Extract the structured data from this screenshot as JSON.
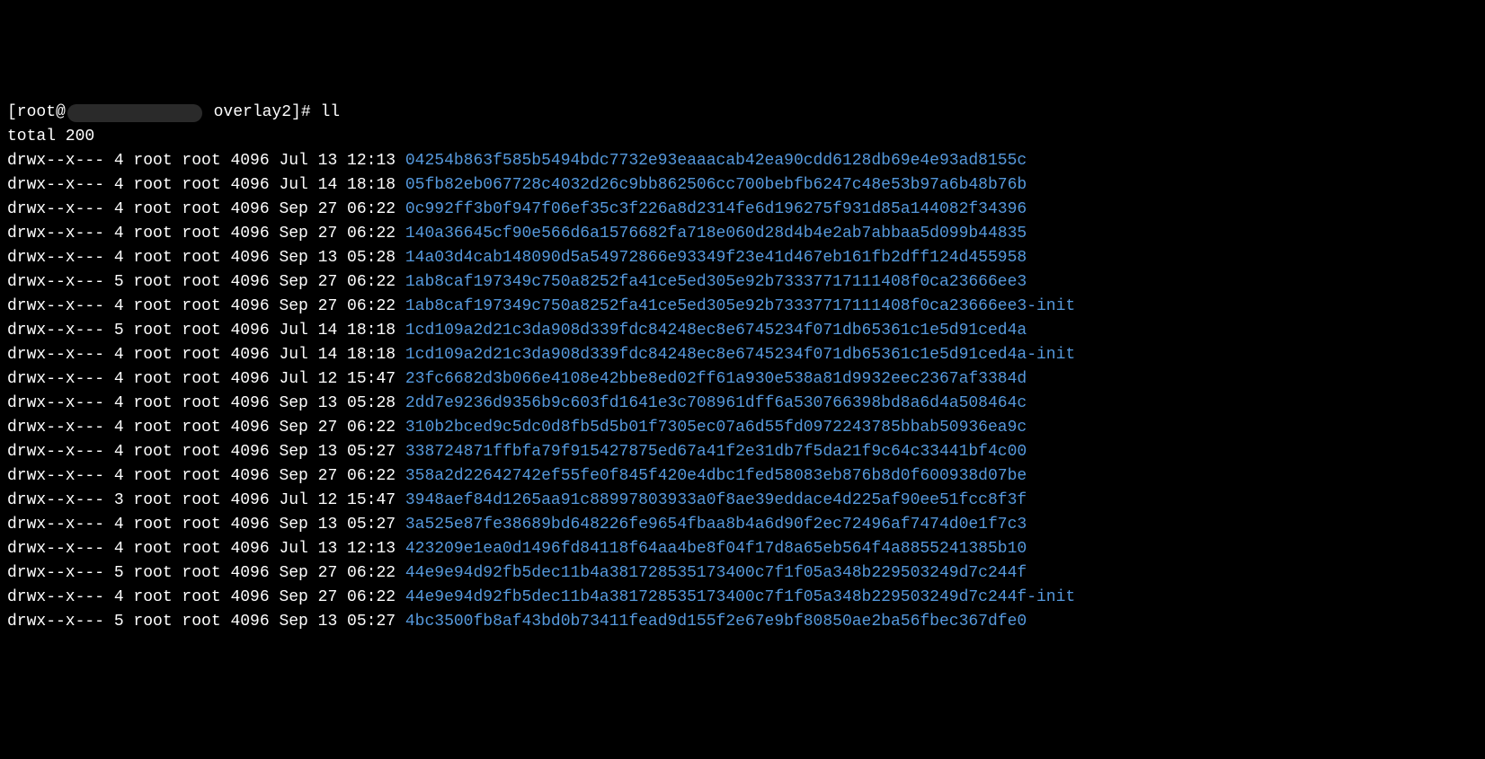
{
  "prompt": {
    "prefix": "[root@",
    "suffix": " overlay2]# ",
    "command": "ll"
  },
  "total": "total 200",
  "rows": [
    {
      "perms": "drwx--x---",
      "links": "4",
      "owner": "root",
      "group": "root",
      "size": "4096",
      "month": "Jul",
      "day": "13",
      "time": "12:13",
      "name": "04254b863f585b5494bdc7732e93eaaacab42ea90cdd6128db69e4e93ad8155c"
    },
    {
      "perms": "drwx--x---",
      "links": "4",
      "owner": "root",
      "group": "root",
      "size": "4096",
      "month": "Jul",
      "day": "14",
      "time": "18:18",
      "name": "05fb82eb067728c4032d26c9bb862506cc700bebfb6247c48e53b97a6b48b76b"
    },
    {
      "perms": "drwx--x---",
      "links": "4",
      "owner": "root",
      "group": "root",
      "size": "4096",
      "month": "Sep",
      "day": "27",
      "time": "06:22",
      "name": "0c992ff3b0f947f06ef35c3f226a8d2314fe6d196275f931d85a144082f34396"
    },
    {
      "perms": "drwx--x---",
      "links": "4",
      "owner": "root",
      "group": "root",
      "size": "4096",
      "month": "Sep",
      "day": "27",
      "time": "06:22",
      "name": "140a36645cf90e566d6a1576682fa718e060d28d4b4e2ab7abbaa5d099b44835"
    },
    {
      "perms": "drwx--x---",
      "links": "4",
      "owner": "root",
      "group": "root",
      "size": "4096",
      "month": "Sep",
      "day": "13",
      "time": "05:28",
      "name": "14a03d4cab148090d5a54972866e93349f23e41d467eb161fb2dff124d455958"
    },
    {
      "perms": "drwx--x---",
      "links": "5",
      "owner": "root",
      "group": "root",
      "size": "4096",
      "month": "Sep",
      "day": "27",
      "time": "06:22",
      "name": "1ab8caf197349c750a8252fa41ce5ed305e92b73337717111408f0ca23666ee3"
    },
    {
      "perms": "drwx--x---",
      "links": "4",
      "owner": "root",
      "group": "root",
      "size": "4096",
      "month": "Sep",
      "day": "27",
      "time": "06:22",
      "name": "1ab8caf197349c750a8252fa41ce5ed305e92b73337717111408f0ca23666ee3-init"
    },
    {
      "perms": "drwx--x---",
      "links": "5",
      "owner": "root",
      "group": "root",
      "size": "4096",
      "month": "Jul",
      "day": "14",
      "time": "18:18",
      "name": "1cd109a2d21c3da908d339fdc84248ec8e6745234f071db65361c1e5d91ced4a"
    },
    {
      "perms": "drwx--x---",
      "links": "4",
      "owner": "root",
      "group": "root",
      "size": "4096",
      "month": "Jul",
      "day": "14",
      "time": "18:18",
      "name": "1cd109a2d21c3da908d339fdc84248ec8e6745234f071db65361c1e5d91ced4a-init"
    },
    {
      "perms": "drwx--x---",
      "links": "4",
      "owner": "root",
      "group": "root",
      "size": "4096",
      "month": "Jul",
      "day": "12",
      "time": "15:47",
      "name": "23fc6682d3b066e4108e42bbe8ed02ff61a930e538a81d9932eec2367af3384d"
    },
    {
      "perms": "drwx--x---",
      "links": "4",
      "owner": "root",
      "group": "root",
      "size": "4096",
      "month": "Sep",
      "day": "13",
      "time": "05:28",
      "name": "2dd7e9236d9356b9c603fd1641e3c708961dff6a530766398bd8a6d4a508464c"
    },
    {
      "perms": "drwx--x---",
      "links": "4",
      "owner": "root",
      "group": "root",
      "size": "4096",
      "month": "Sep",
      "day": "27",
      "time": "06:22",
      "name": "310b2bced9c5dc0d8fb5d5b01f7305ec07a6d55fd0972243785bbab50936ea9c"
    },
    {
      "perms": "drwx--x---",
      "links": "4",
      "owner": "root",
      "group": "root",
      "size": "4096",
      "month": "Sep",
      "day": "13",
      "time": "05:27",
      "name": "338724871ffbfa79f915427875ed67a41f2e31db7f5da21f9c64c33441bf4c00"
    },
    {
      "perms": "drwx--x---",
      "links": "4",
      "owner": "root",
      "group": "root",
      "size": "4096",
      "month": "Sep",
      "day": "27",
      "time": "06:22",
      "name": "358a2d22642742ef55fe0f845f420e4dbc1fed58083eb876b8d0f600938d07be"
    },
    {
      "perms": "drwx--x---",
      "links": "3",
      "owner": "root",
      "group": "root",
      "size": "4096",
      "month": "Jul",
      "day": "12",
      "time": "15:47",
      "name": "3948aef84d1265aa91c88997803933a0f8ae39eddace4d225af90ee51fcc8f3f"
    },
    {
      "perms": "drwx--x---",
      "links": "4",
      "owner": "root",
      "group": "root",
      "size": "4096",
      "month": "Sep",
      "day": "13",
      "time": "05:27",
      "name": "3a525e87fe38689bd648226fe9654fbaa8b4a6d90f2ec72496af7474d0e1f7c3"
    },
    {
      "perms": "drwx--x---",
      "links": "4",
      "owner": "root",
      "group": "root",
      "size": "4096",
      "month": "Jul",
      "day": "13",
      "time": "12:13",
      "name": "423209e1ea0d1496fd84118f64aa4be8f04f17d8a65eb564f4a8855241385b10"
    },
    {
      "perms": "drwx--x---",
      "links": "5",
      "owner": "root",
      "group": "root",
      "size": "4096",
      "month": "Sep",
      "day": "27",
      "time": "06:22",
      "name": "44e9e94d92fb5dec11b4a381728535173400c7f1f05a348b229503249d7c244f"
    },
    {
      "perms": "drwx--x---",
      "links": "4",
      "owner": "root",
      "group": "root",
      "size": "4096",
      "month": "Sep",
      "day": "27",
      "time": "06:22",
      "name": "44e9e94d92fb5dec11b4a381728535173400c7f1f05a348b229503249d7c244f-init"
    },
    {
      "perms": "drwx--x---",
      "links": "5",
      "owner": "root",
      "group": "root",
      "size": "4096",
      "month": "Sep",
      "day": "13",
      "time": "05:27",
      "name": "4bc3500fb8af43bd0b73411fead9d155f2e67e9bf80850ae2ba56fbec367dfe0"
    }
  ]
}
